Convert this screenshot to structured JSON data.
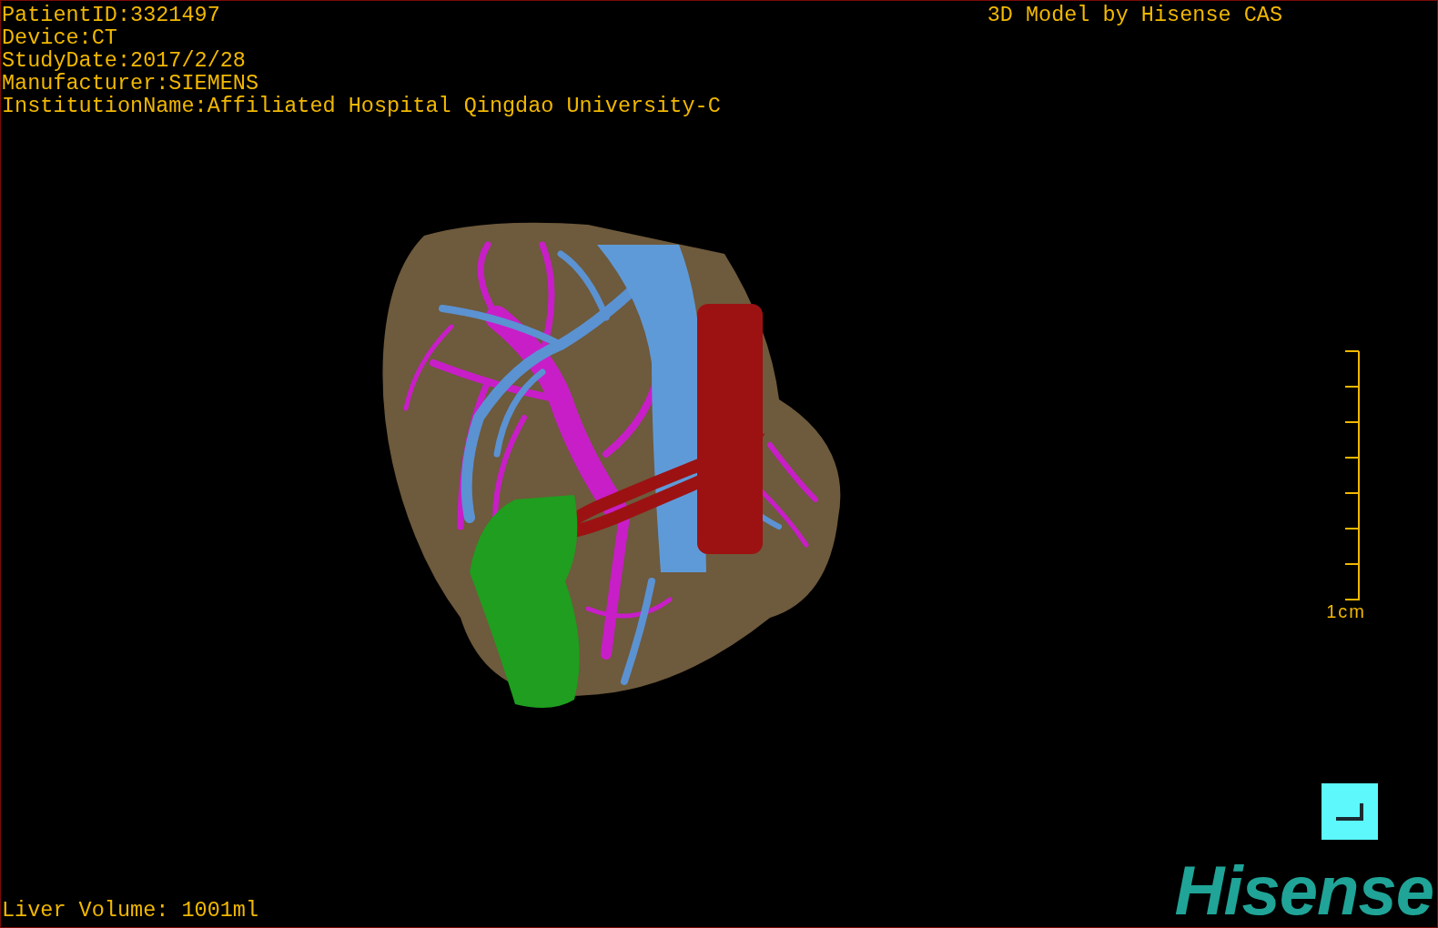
{
  "patient_info": [
    "PatientID:3321497",
    "Device:CT",
    "StudyDate:2017/2/28",
    "Manufacturer:SIEMENS",
    "InstitutionName:Affiliated Hospital Qingdao University-C"
  ],
  "title": "3D Model by Hisense CAS",
  "scale_bar": {
    "label": "1cm"
  },
  "liver_volume": "Liver Volume: 1001ml",
  "logo": "Hisense"
}
